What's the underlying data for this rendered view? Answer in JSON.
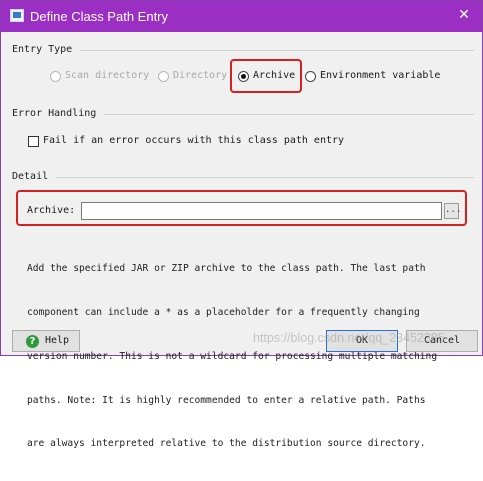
{
  "window": {
    "title": "Define Class Path Entry",
    "close_glyph": "✕"
  },
  "entry_type": {
    "label": "Entry Type",
    "options": [
      {
        "label": "Scan directory",
        "checked": false,
        "enabled": false
      },
      {
        "label": "Directory",
        "checked": false,
        "enabled": false
      },
      {
        "label": "Archive",
        "checked": true,
        "enabled": true
      },
      {
        "label": "Environment variable",
        "checked": false,
        "enabled": true
      }
    ]
  },
  "error_handling": {
    "label": "Error Handling",
    "checkbox_label": "Fail if an error occurs with this class path entry",
    "checked": false
  },
  "detail": {
    "label": "Detail",
    "field_label": "Archive:",
    "field_value": "",
    "browse_label": "...",
    "description": [
      "Add the specified JAR or ZIP archive to the class path. The last path",
      "component can include a * as a placeholder for a frequently changing",
      "version number. This is not a wildcard for processing multiple matching",
      "paths. Note: It is highly recommended to enter a relative path. Paths",
      "are always interpreted relative to the distribution source directory."
    ]
  },
  "buttons": {
    "help": "Help",
    "ok": "OK",
    "cancel": "Cancel"
  },
  "watermark": "https://blog.csdn.net/qq_23452385",
  "colors": {
    "titlebar": "#9b2fc3",
    "highlight": "#d62020"
  }
}
